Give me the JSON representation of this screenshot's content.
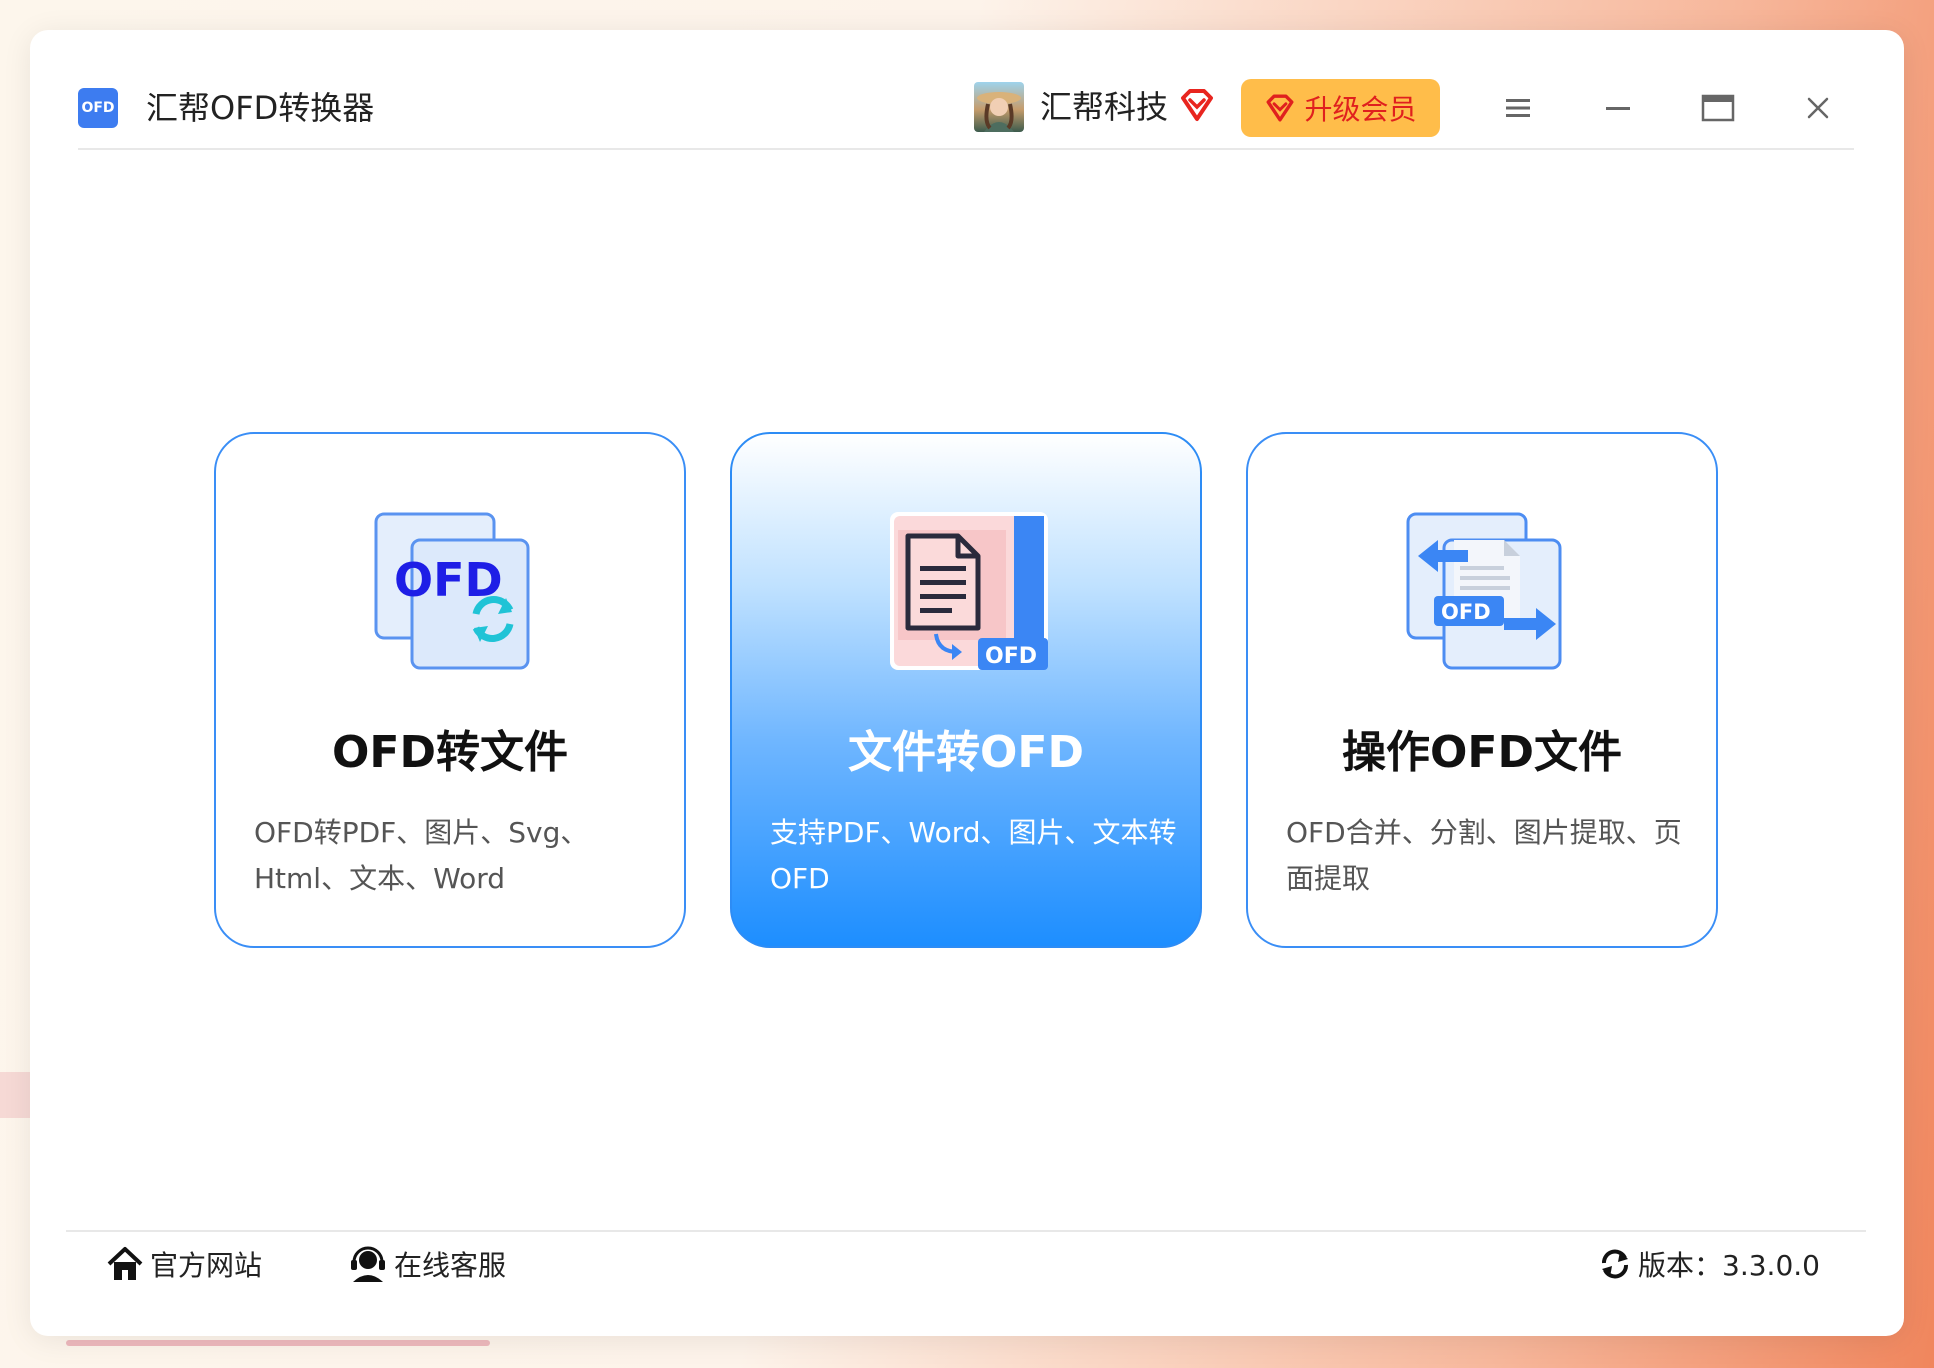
{
  "app": {
    "logo_text": "OFD",
    "title": "汇帮OFD转换器"
  },
  "user": {
    "name": "汇帮科技"
  },
  "upgrade": {
    "label": "升级会员"
  },
  "cards": [
    {
      "title": "OFD转文件",
      "desc": "OFD转PDF、图片、Svg、Html、文本、Word",
      "icon_text": "OFD",
      "icon": "ofd-convert-icon"
    },
    {
      "title": "文件转OFD",
      "desc": "支持PDF、Word、图片、文本转OFD",
      "icon_text": "OFD",
      "icon": "file-to-ofd-icon"
    },
    {
      "title": "操作OFD文件",
      "desc": "OFD合并、分割、图片提取、页面提取",
      "icon_text": "OFD",
      "icon": "ofd-operate-icon"
    }
  ],
  "footer": {
    "website_label": "官方网站",
    "service_label": "在线客服",
    "version_label": "版本：3.3.0.0"
  },
  "colors": {
    "accent": "#3a8ef6",
    "upgrade_bg": "#ffbd4a",
    "upgrade_text": "#e0201e"
  }
}
